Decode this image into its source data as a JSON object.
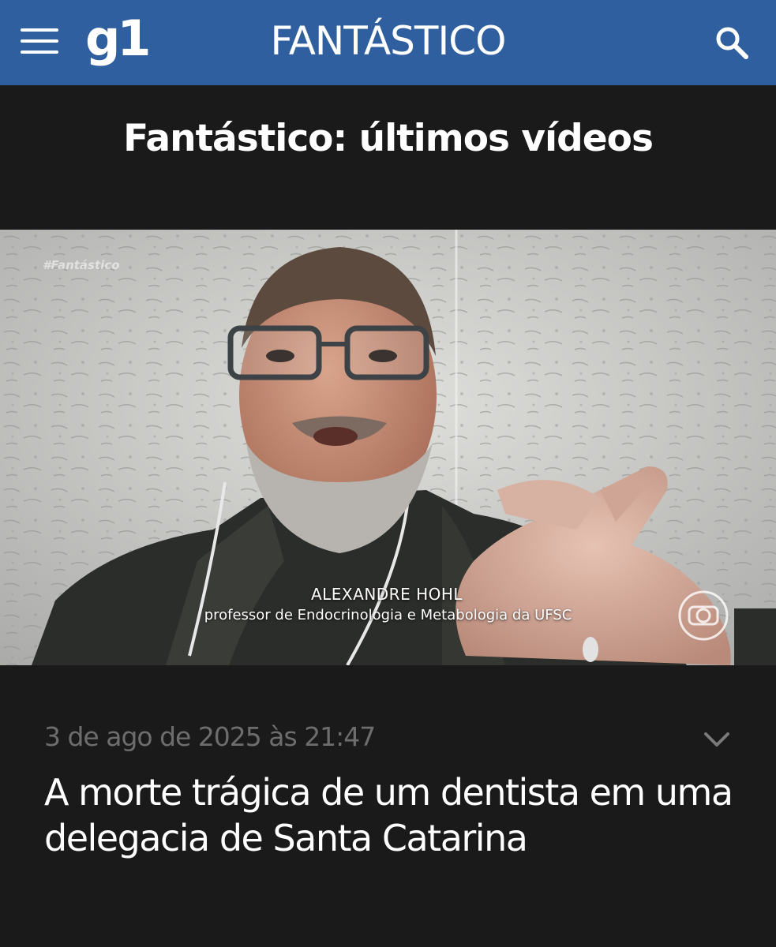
{
  "header": {
    "logo": "g1",
    "section": "FANTÁSTICO",
    "menu_icon": "hamburger-menu-icon",
    "search_icon": "search-icon",
    "background_color": "#2f5f9e"
  },
  "page": {
    "heading": "Fantástico: últimos vídeos"
  },
  "video": {
    "watermark": "#Fantástico",
    "lower_third": {
      "name": "ALEXANDRE HOHL",
      "role": "professor de Endocrinologia e Metabologia da UFSC"
    },
    "broadcaster_icon": "globo-logo-icon"
  },
  "article": {
    "date": "3 de ago de 2025 às 21:47",
    "title": "A morte trágica de um dentista em uma delegacia de Santa Catarina",
    "expand_icon": "chevron-down-icon"
  }
}
